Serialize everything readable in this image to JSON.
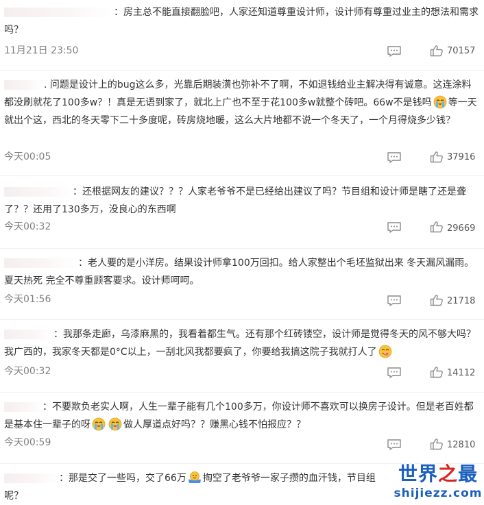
{
  "comments": [
    {
      "text": "：房主总不能直接翻脸吧，人家还知道尊重设计师，设计师有尊重过业主的想法和需求吗？",
      "time": "11月21日 23:50",
      "likes": "70157"
    },
    {
      "text_a": ". 问题是设计上的bug这么多，光靠后期装潢也弥补不了啊，不如退钱给业主解决得有诚意。这连涂料都没刷就花了100多w？！真是无语到家了，就北上广也不至于花100多w就整个砖吧。66w不是钱吗",
      "text_b": "等一天就出个这，西北的冬天零下二十多度呢，砖房烧地暖，这么大片地都不说一个冬天了，一个月得烧多少钱？",
      "time": "今天00:05",
      "likes": "37916"
    },
    {
      "text": "：还根据网友的建议？？？人家老爷爷不是已经给出建议了吗？节目组和设计师是瞎了还是聋了？？还用了130多万，没良心的东西啊",
      "time": "今天00:32",
      "likes": "29669"
    },
    {
      "text": "：老人要的是小洋房。结果设计师拿100万回扣。给人家整出个毛坯监狱出来 冬天漏风漏雨。夏天热死 完全不尊重顾客要求。设计师呵呵。",
      "time": "今天01:56",
      "likes": "21718"
    },
    {
      "text": "：我那条走廊，乌漆麻黑的，我看着都生气。还有那个红砖镂空，设计师是觉得冬天的风不够大吗？我广西的，我家冬天都是0°C以上，一刮北风我都要疯了，你要给我搞这院子我就打人了",
      "time": "今天00:32",
      "likes": "14112"
    },
    {
      "text_a": "：不要欺负老实人啊，人生一辈子能有几个100多万，你设计师不喜欢可以换房子设计。但是老百姓都是基本住一辈子的呀",
      "text_b": "做人厚道点好吗？？赚黑心钱不怕报应？？",
      "time": "今天00:59",
      "likes": "12810"
    },
    {
      "text_a": "：那是交了一些吗，交了66万",
      "text_b": "掏空了老爷爷一家子攒的血汗钱，节目组",
      "text_c": "呢？"
    }
  ],
  "watermark": {
    "title_a": "世界",
    "title_b": "之",
    "title_c": "最",
    "url": "shijiezz.com"
  },
  "icons": {
    "comment": "comment-icon",
    "like": "thumbs-up-icon",
    "emoji_cry": "crying-face-emoji",
    "emoji_drool": "drooling-face-emoji",
    "emoji_shrug": "shrug-emoji"
  },
  "colors": {
    "text": "#333333",
    "meta": "#808080",
    "watermark_blue": "#1b5fbf",
    "watermark_red": "#d9261c"
  }
}
